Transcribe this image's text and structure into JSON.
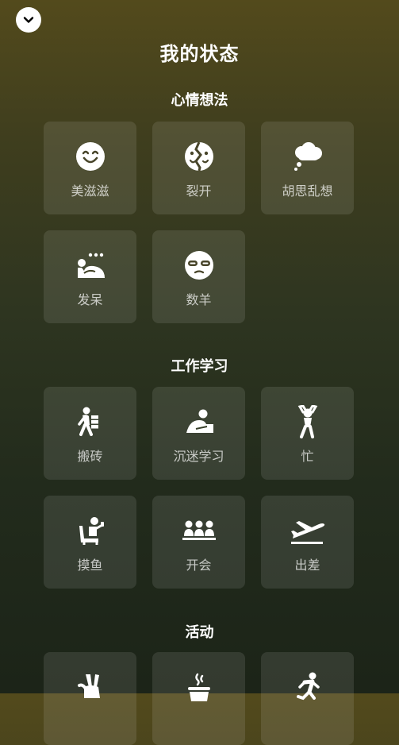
{
  "header": {
    "collapse_icon": "chevron-down-icon"
  },
  "page": {
    "title": "我的状态"
  },
  "sections": [
    {
      "title": "心情想法",
      "items": [
        {
          "label": "美滋滋",
          "icon": "smile-icon"
        },
        {
          "label": "裂开",
          "icon": "split-face-icon"
        },
        {
          "label": "胡思乱想",
          "icon": "thought-cloud-icon"
        },
        {
          "label": "发呆",
          "icon": "daydream-icon"
        },
        {
          "label": "数羊",
          "icon": "sleep-mask-icon"
        }
      ]
    },
    {
      "title": "工作学习",
      "items": [
        {
          "label": "搬砖",
          "icon": "carry-bricks-icon"
        },
        {
          "label": "沉迷学习",
          "icon": "studying-icon"
        },
        {
          "label": "忙",
          "icon": "busy-person-icon"
        },
        {
          "label": "摸鱼",
          "icon": "slacking-icon"
        },
        {
          "label": "开会",
          "icon": "meeting-icon"
        },
        {
          "label": "出差",
          "icon": "airplane-icon"
        }
      ]
    },
    {
      "title": "活动",
      "items": [
        {
          "label": "",
          "icon": "peace-hand-icon"
        },
        {
          "label": "",
          "icon": "hot-drink-icon"
        },
        {
          "label": "",
          "icon": "running-icon"
        }
      ]
    }
  ]
}
